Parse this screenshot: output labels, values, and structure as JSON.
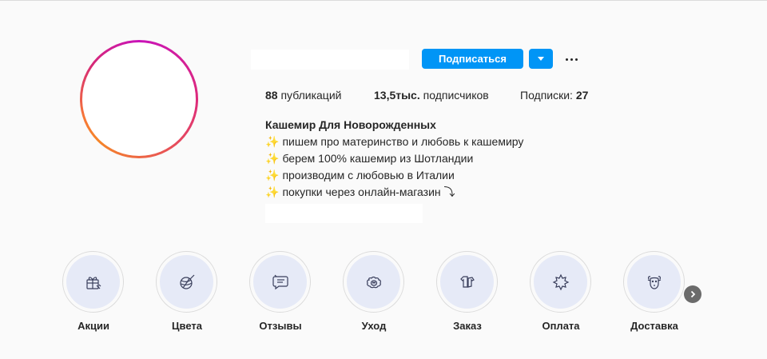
{
  "header": {
    "follow_label": "Подписаться",
    "more_icon": "more-horizontal-icon",
    "dropdown_icon": "caret-down-icon"
  },
  "stats": {
    "posts_count": "88",
    "posts_label": "публикаций",
    "followers_count": "13,5тыс.",
    "followers_label": "подписчиков",
    "following_label": "Подписки:",
    "following_count": "27"
  },
  "bio": {
    "name": "Кашемир Для Новорожденных",
    "sparkle": "✨",
    "lines": [
      "пишем про материнство и любовь к кашемиру",
      "берем 100% кашемир из Шотландии",
      "производим с любовью в Италии",
      "покупки через онлайн-магазин ⤵"
    ]
  },
  "highlights": [
    {
      "label": "Акции",
      "icon": "gift-icon"
    },
    {
      "label": "Цвета",
      "icon": "yarn-ball-icon"
    },
    {
      "label": "Отзывы",
      "icon": "speech-bubble-icon"
    },
    {
      "label": "Уход",
      "icon": "sheep-icon"
    },
    {
      "label": "Заказ",
      "icon": "clothes-icon"
    },
    {
      "label": "Оплата",
      "icon": "star-badge-icon"
    },
    {
      "label": "Доставка",
      "icon": "goat-icon"
    }
  ],
  "colors": {
    "accent": "#0095f6",
    "highlight_fill": "#e6eaf7",
    "icon_stroke": "#3a3f5c"
  }
}
